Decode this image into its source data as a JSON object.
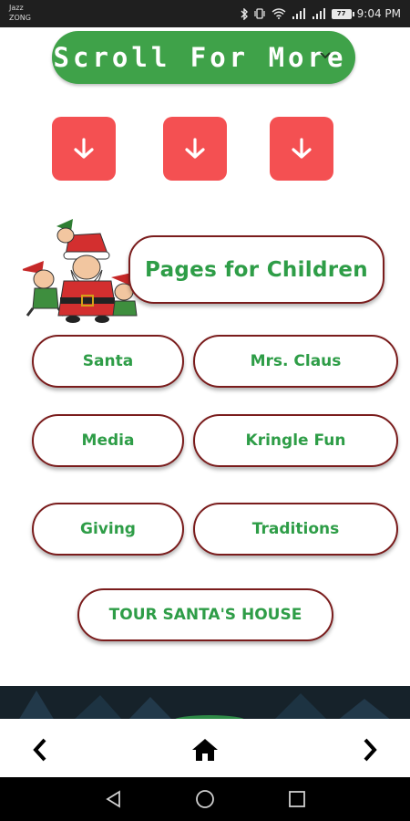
{
  "status_bar": {
    "carrier_line1": "Jazz",
    "carrier_line2": "ZONG",
    "battery": "77",
    "time": "9:04 PM"
  },
  "banner": {
    "label": "Scroll For More",
    "icon": "chevron-down-icon",
    "color": "#3fa249"
  },
  "arrow_buttons": [
    {
      "icon": "arrow-down-icon"
    },
    {
      "icon": "arrow-down-icon"
    },
    {
      "icon": "arrow-down-icon"
    }
  ],
  "arrow_color": "#f45052",
  "section": {
    "title": "Pages for Children",
    "image": "santa-elves-illustration"
  },
  "menu": {
    "santa": "Santa",
    "mrs_claus": "Mrs. Claus",
    "media": "Media",
    "kringle_fun": "Kringle Fun",
    "giving": "Giving",
    "traditions": "Traditions",
    "tour": "TOUR SANTA'S HOUSE"
  },
  "colors": {
    "text_green": "#2e9d47",
    "border_maroon": "#7a1c1c"
  },
  "nav": {
    "back": "chevron-left-icon",
    "home": "home-icon",
    "forward": "chevron-right-icon"
  },
  "system_nav": {
    "back": "triangle-back-icon",
    "home": "circle-home-icon",
    "recents": "square-recents-icon"
  }
}
